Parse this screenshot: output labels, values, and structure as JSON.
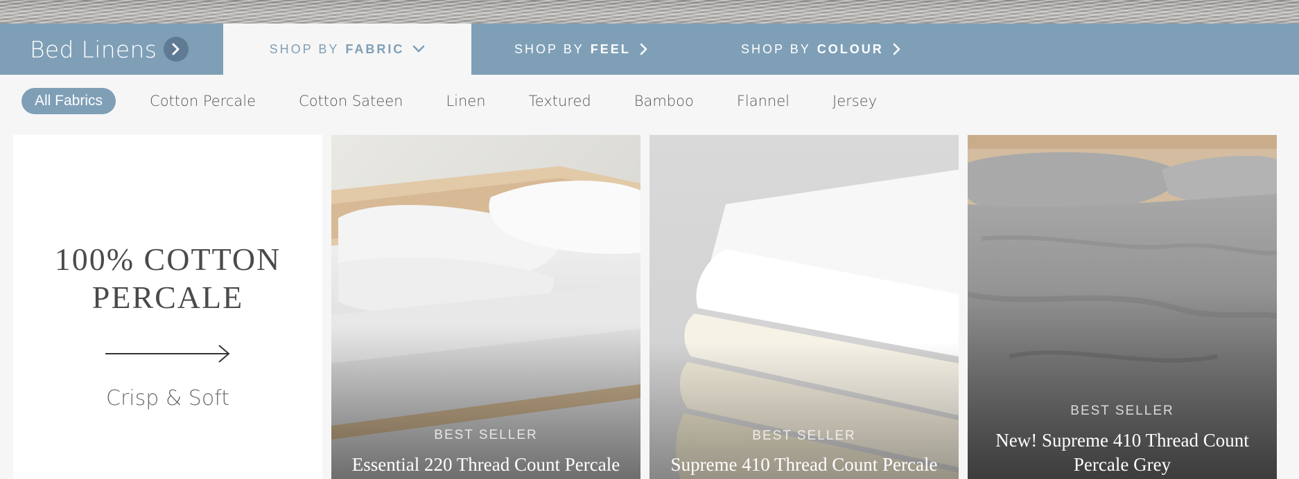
{
  "nav": {
    "brand_label": "Bed Linens",
    "tabs": [
      {
        "prefix": "SHOP BY",
        "strong": "FABRIC",
        "icon": "chevron-down-icon"
      },
      {
        "prefix": "SHOP BY",
        "strong": "FEEL",
        "icon": "chevron-right-icon"
      },
      {
        "prefix": "SHOP BY",
        "strong": "COLOUR",
        "icon": "chevron-right-icon"
      }
    ]
  },
  "filters": [
    "All Fabrics",
    "Cotton Percale",
    "Cotton Sateen",
    "Linen",
    "Textured",
    "Bamboo",
    "Flannel",
    "Jersey"
  ],
  "intro": {
    "title": "100% COTTON PERCALE",
    "subtitle": "Crisp & Soft",
    "icon": "arrow-right-icon"
  },
  "products": [
    {
      "badge": "BEST SELLER",
      "name": "Essential 220 Thread Count Percale"
    },
    {
      "badge": "BEST SELLER",
      "name": "Supreme 410 Thread Count Percale"
    },
    {
      "badge": "BEST SELLER",
      "name": "New! Supreme 410 Thread Count Percale Grey"
    }
  ],
  "colors": {
    "nav_blue": "#7f9fb7",
    "page_bg": "#f6f6f6",
    "brand_chevron_bg": "#5e7b93"
  }
}
